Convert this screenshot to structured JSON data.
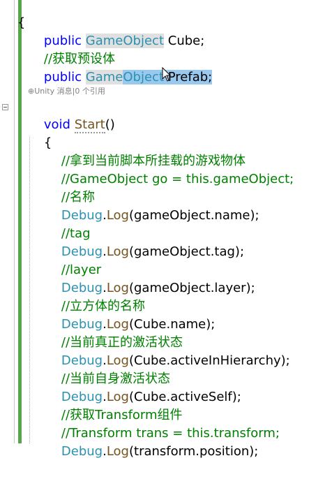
{
  "editor": {
    "lines": {
      "open_brace": "{",
      "cube_kw": "public",
      "cube_type": "GameObject",
      "cube_name": "Cube;",
      "comment_prefab": "//获取预设体",
      "prefab_kw": "public",
      "prefab_type_a": "Game",
      "prefab_type_b": "Object",
      "prefab_name": "Prefab;",
      "codelens": "⊕Unity 消息|0 个引用",
      "start_kw": "void",
      "start_name": "Start",
      "start_parens": "()",
      "start_brace": "{",
      "c1": "//拿到当前脚本所挂载的游戏物体",
      "c2": "//GameObject go = this.gameObject;",
      "c3": "//名称",
      "d1_args": "(gameObject.name);",
      "c4": "//tag",
      "d2_args": "(gameObject.tag);",
      "c5": "//layer",
      "d3_args": "(gameObject.layer);",
      "c6": "//立方体的名称",
      "d4_args": "(Cube.name);",
      "c7": "//当前真正的激活状态",
      "d5_args": "(Cube.activeInHierarchy);",
      "c8": "//当前自身激活状态",
      "d6_args": "(Cube.activeSelf);",
      "c9": "//获取Transform组件",
      "c10": "//Transform trans = this.transform;",
      "d7_args": "(transform.position);",
      "debug": "Debug",
      "dot": ".",
      "log": "Log"
    }
  },
  "colors": {
    "keyword": "#0000ff",
    "type": "#2b91af",
    "method": "#74531f",
    "comment": "#008000",
    "selection": "#99c9ef",
    "change_bar": "#57a64a"
  },
  "icons": {
    "fold": "fold-collapse-icon",
    "cursor": "mouse-pointer-icon"
  }
}
